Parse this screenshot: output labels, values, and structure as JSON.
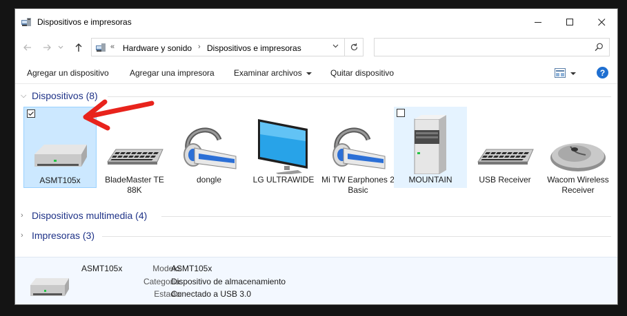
{
  "window": {
    "title": "Dispositivos e impresoras"
  },
  "address": {
    "overflow": "«",
    "crumbs": [
      "Hardware y sonido",
      "Dispositivos e impresoras"
    ],
    "search_placeholder": ""
  },
  "toolbar": {
    "add_device": "Agregar un dispositivo",
    "add_printer": "Agregar una impresora",
    "browse_files": "Examinar archivos",
    "remove_device": "Quitar dispositivo",
    "help": "?"
  },
  "groups": {
    "devices": "Dispositivos (8)",
    "multimedia": "Dispositivos multimedia (4)",
    "printers": "Impresoras (3)"
  },
  "devices": [
    {
      "label": "ASMT105x",
      "icon": "drive-icon",
      "selected": true
    },
    {
      "label": "BladeMaster TE 88K",
      "icon": "keyboard-icon"
    },
    {
      "label": "dongle",
      "icon": "headset-icon"
    },
    {
      "label": "LG ULTRAWIDE",
      "icon": "monitor-icon"
    },
    {
      "label": "Mi TW Earphones 2 Basic",
      "icon": "headset-icon"
    },
    {
      "label": "MOUNTAIN",
      "icon": "computer-tower-icon",
      "hovered": true
    },
    {
      "label": "USB Receiver",
      "icon": "keyboard-icon"
    },
    {
      "label": "Wacom Wireless Receiver",
      "icon": "mouse-icon"
    }
  ],
  "details": {
    "name": "ASMT105x",
    "model_label": "Modelo:",
    "model_value": "ASMT105x",
    "category_label": "Categoría:",
    "category_value": "Dispositivo de almacenamiento",
    "status_label": "Estado:",
    "status_value": "Conectado a USB 3.0"
  },
  "colors": {
    "selection_bg": "#cce8ff",
    "hover_bg": "#e5f3ff",
    "group_text": "#1e3287",
    "annotation_arrow": "#e8231c",
    "details_bg": "#f3f8ff"
  }
}
